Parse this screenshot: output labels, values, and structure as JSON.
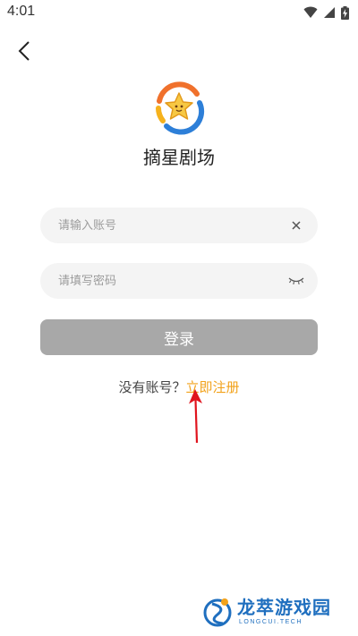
{
  "status_bar": {
    "time": "4:01",
    "icons": [
      "wifi-icon",
      "signal-icon",
      "battery-charging-icon"
    ]
  },
  "header": {
    "back_icon": "chevron-left-icon"
  },
  "app": {
    "name": "摘星剧场",
    "logo_icon": "star-logo-icon"
  },
  "form": {
    "account": {
      "value": "",
      "placeholder": "请输入账号",
      "clear_icon": "close-icon"
    },
    "password": {
      "value": "",
      "placeholder": "请填写密码",
      "toggle_icon": "eye-closed-icon"
    },
    "login_label": "登录"
  },
  "register": {
    "prompt": "没有账号？",
    "link": "立即注册"
  },
  "watermark": {
    "text": "龙萃游戏园",
    "subtext": "LONGCUI.TECH"
  },
  "colors": {
    "background": "#ffffff",
    "field_bg": "#f4f4f4",
    "login_button": "#a8a8a8",
    "link": "#f2a21b",
    "annotation_arrow": "#e0141e",
    "watermark": "#1f6fbf"
  }
}
